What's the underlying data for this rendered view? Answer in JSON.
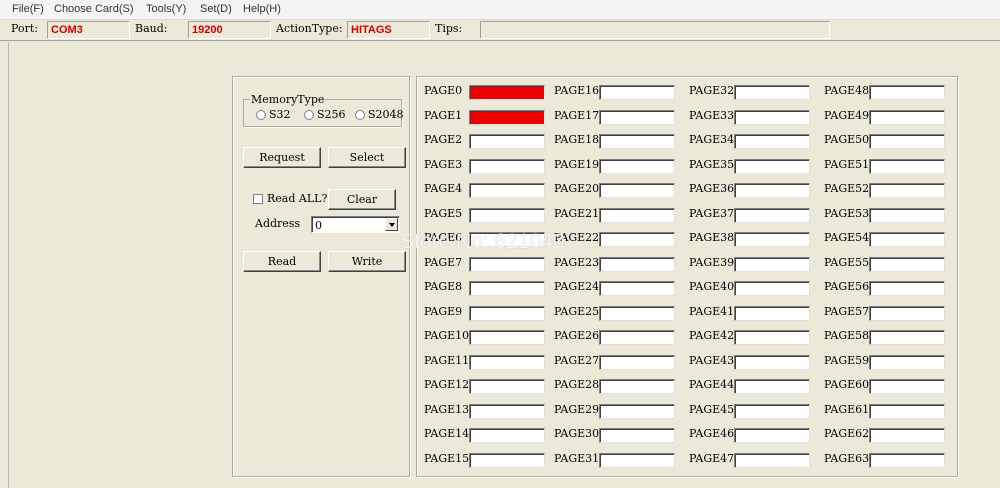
{
  "menu": [
    "File(F)",
    "Choose Card(S)",
    "Tools(Y)",
    "Set(D)",
    "Help(H)"
  ],
  "status": {
    "port_label": "Port:",
    "port_value": "COM3",
    "baud_label": "Baud:",
    "baud_value": "19200",
    "action_label": "ActionType:",
    "action_value": "HITAGS",
    "tips_label": "Tips:",
    "tips_value": ""
  },
  "memory": {
    "title": "MemoryType",
    "options": [
      "S32",
      "S256",
      "S2048"
    ]
  },
  "controls": {
    "request": "Request",
    "select": "Select",
    "read_all": "Read ALL?",
    "clear": "Clear",
    "address_label": "Address",
    "address_value": "0",
    "read": "Read",
    "write": "Write"
  },
  "pages": [
    "PAGE0",
    "PAGE1",
    "PAGE2",
    "PAGE3",
    "PAGE4",
    "PAGE5",
    "PAGE6",
    "PAGE7",
    "PAGE8",
    "PAGE9",
    "PAGE10",
    "PAGE11",
    "PAGE12",
    "PAGE13",
    "PAGE14",
    "PAGE15",
    "PAGE16",
    "PAGE17",
    "PAGE18",
    "PAGE19",
    "PAGE20",
    "PAGE21",
    "PAGE22",
    "PAGE23",
    "PAGE24",
    "PAGE25",
    "PAGE26",
    "PAGE27",
    "PAGE28",
    "PAGE29",
    "PAGE30",
    "PAGE31",
    "PAGE32",
    "PAGE33",
    "PAGE34",
    "PAGE35",
    "PAGE36",
    "PAGE37",
    "PAGE38",
    "PAGE39",
    "PAGE40",
    "PAGE41",
    "PAGE42",
    "PAGE43",
    "PAGE44",
    "PAGE45",
    "PAGE46",
    "PAGE47",
    "PAGE48",
    "PAGE49",
    "PAGE50",
    "PAGE51",
    "PAGE52",
    "PAGE53",
    "PAGE54",
    "PAGE55",
    "PAGE56",
    "PAGE57",
    "PAGE58",
    "PAGE59",
    "PAGE60",
    "PAGE61",
    "PAGE62",
    "PAGE63"
  ],
  "filled_pages": [
    0,
    1
  ],
  "filled_color": "#ee0000",
  "watermark": "Store No: 621040"
}
